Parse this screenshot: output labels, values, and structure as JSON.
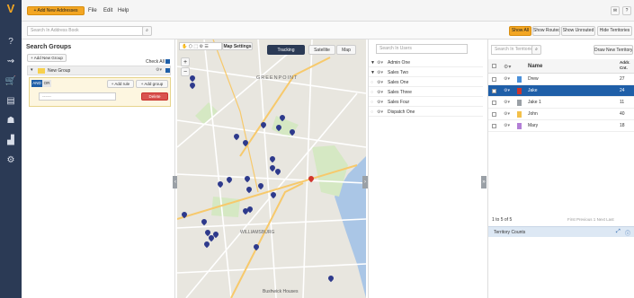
{
  "topbar": {
    "add_addresses": "+ Add New Addresses",
    "menu": [
      "File",
      "Edit",
      "Help"
    ]
  },
  "bar2": {
    "search_placeholder": "Search In Address Book",
    "territory_filters": [
      "Show All",
      "Show Routed",
      "Show Unrouted",
      "Hide Territories"
    ]
  },
  "left": {
    "title": "Search Groups",
    "add_group_button": "+ Add New Group",
    "check_all": "Check All",
    "group_name": "New Group",
    "and_label": "AND",
    "or_label": "OR",
    "rule_field": "------",
    "add_rule": "+ Add rule",
    "add_group": "+ Add group",
    "delete": "Delete"
  },
  "map": {
    "settings": "Map Settings",
    "tracking": "Tracking",
    "satellite": "Satellite",
    "map_label": "Map",
    "greenpoint": "GREENPOINT",
    "williamsburg": "WILLIAMSBURG",
    "bushwick": "Bushwick Houses"
  },
  "users": {
    "search_placeholder": "Search In Users",
    "items": [
      {
        "name": "Admin One",
        "color": "#c0392b"
      },
      {
        "name": "Sales Two",
        "color": "#c0392b"
      },
      {
        "name": "Sales One",
        "color": "#cccccc"
      },
      {
        "name": "Sales Three",
        "color": "#cccccc"
      },
      {
        "name": "Sales Four",
        "color": "#cccccc"
      },
      {
        "name": "Dispatch One",
        "color": "#cccccc"
      }
    ]
  },
  "territories": {
    "search_placeholder": "Search In Territories",
    "draw_button": "Draw New Territory",
    "col_name": "Name",
    "col_addrs": "Addr. Cnt.",
    "rows": [
      {
        "name": "Drew",
        "count": "27",
        "color": "#4a90d9",
        "selected": false
      },
      {
        "name": "Jake",
        "count": "24",
        "color": "#d0342c",
        "selected": true
      },
      {
        "name": "Jake 1",
        "count": "11",
        "color": "#9aa0a6",
        "selected": false
      },
      {
        "name": "John",
        "count": "40",
        "color": "#f3c04a",
        "selected": false
      },
      {
        "name": "Mary",
        "count": "18",
        "color": "#b37fd6",
        "selected": false
      }
    ],
    "pagination_info": "1 to 5 of 5",
    "pager": [
      "First",
      "Previous",
      "1",
      "Next",
      "Last"
    ],
    "counts_title": "Territory Counts"
  }
}
